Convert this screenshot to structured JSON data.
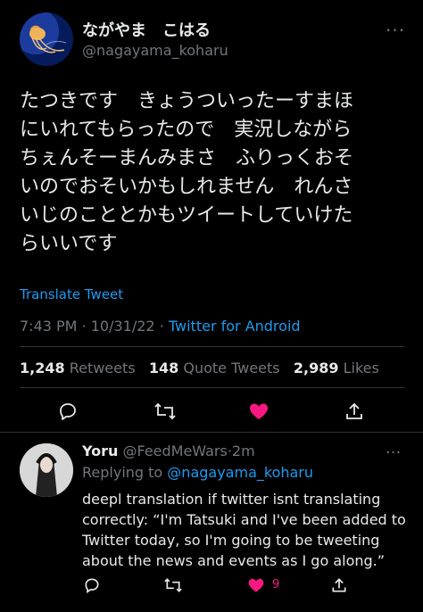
{
  "header": {
    "display_name": "ながやま　こはる",
    "handle": "@nagayama_koharu",
    "more_label": "···"
  },
  "tweet": {
    "text": "たつきです　きょうついったーすまほ\nにいれてもらったので　実況しながら\nちぇんそーまんみまさ　ふりっくおそ\nいのでおそいかもしれません　れんさ\nいじのこととかもツイートしていけた\nらいいです",
    "translate_label": "Translate Tweet",
    "time": "7:43 PM",
    "date": "10/31/22",
    "separator": "·",
    "source": "Twitter for Android"
  },
  "stats": {
    "retweets_count": "1,248",
    "retweets_label": "Retweets",
    "quotes_count": "148",
    "quotes_label": "Quote Tweets",
    "likes_count": "2,989",
    "likes_label": "Likes"
  },
  "actions": {
    "icons": [
      "reply-icon",
      "retweet-icon",
      "like-icon",
      "share-icon"
    ],
    "like_color": "#f91880"
  },
  "reply": {
    "name": "Yoru",
    "handle": "@FeedMeWars",
    "sep": "·",
    "time": "2m",
    "more_label": "···",
    "replying_label": "Replying to",
    "replying_to": "@nagayama_koharu",
    "text": "deepl translation if twitter isnt translating correctly: “I'm Tatsuki and I've been added to Twitter today, so I'm going to be tweeting about the news and events as I go along.”",
    "like_count": "9"
  },
  "colors": {
    "background": "#000000",
    "text": "#e7e9ea",
    "muted": "#71767b",
    "link": "#1d9bf0",
    "like": "#f91880"
  }
}
